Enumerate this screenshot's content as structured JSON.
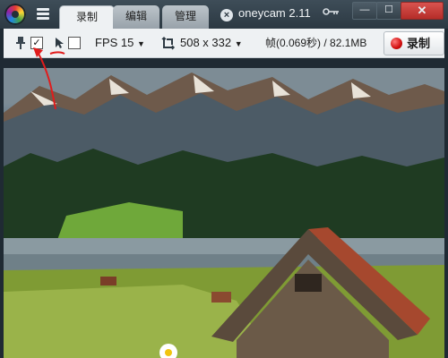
{
  "tabs": [
    {
      "label": "录制"
    },
    {
      "label": "编辑"
    },
    {
      "label": "管理"
    }
  ],
  "window": {
    "title": "oneycam 2.11",
    "close_tab_glyph": "×",
    "minimize_glyph": "—",
    "maximize_glyph": "☐",
    "close_glyph": "✕"
  },
  "toolbar": {
    "pin_checked": "✓",
    "fps_label": "FPS 15",
    "size_label": "508 x 332",
    "stats_label": "帧(0.069秒) / 82.1MB",
    "record_label": "录制"
  },
  "colors": {
    "accent_red": "#d10f0f",
    "annotation_red": "#e11c1c",
    "titlebar": "#2c3943",
    "toolbar_bg": "#eef1f3"
  },
  "icons": [
    "menu-icon",
    "pin-icon",
    "checkbox-icon",
    "cursor-icon",
    "resize-icon",
    "key-icon",
    "record-icon"
  ]
}
